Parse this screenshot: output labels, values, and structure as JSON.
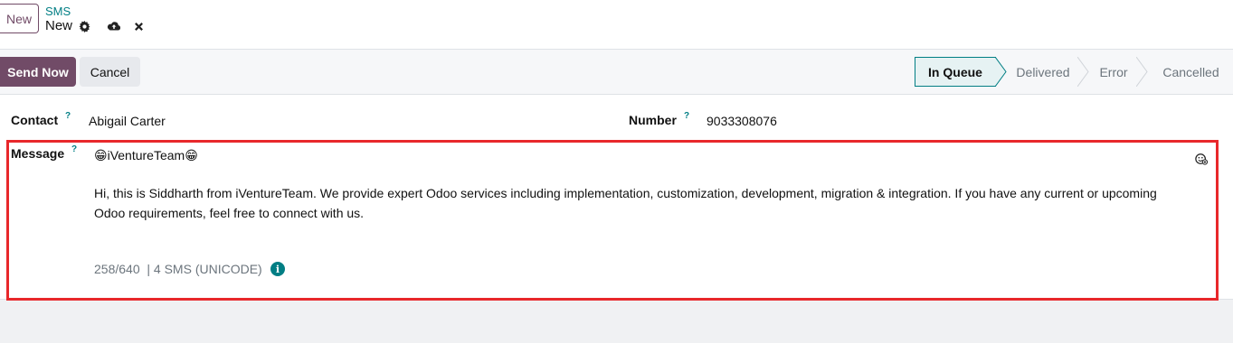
{
  "control_panel": {
    "new_button": "New",
    "breadcrumb": "SMS",
    "record_title": "New",
    "icons": [
      "gear-icon",
      "cloud-upload-icon",
      "close-icon"
    ]
  },
  "status_bar": {
    "send_button": "Send Now",
    "cancel_button": "Cancel",
    "stages": [
      {
        "label": "In Queue",
        "active": true
      },
      {
        "label": "Delivered",
        "active": false
      },
      {
        "label": "Error",
        "active": false
      },
      {
        "label": "Cancelled",
        "active": false
      }
    ]
  },
  "form": {
    "contact_label": "Contact",
    "contact_value": "Abigail Carter",
    "number_label": "Number",
    "number_value": "9033308076",
    "help_mark": "?",
    "message_label": "Message",
    "message_title": "😁iVentureTeam😁",
    "message_body": "Hi, this is Siddharth from iVentureTeam. We provide expert Odoo services including implementation, customization, development, migration & integration. If you have any current or upcoming Odoo requirements, feel free to connect with us.",
    "counter": "258/640  | 4 SMS (UNICODE)",
    "info_icon": "info-icon",
    "emoji_icon": "emoji-picker-icon"
  },
  "colors": {
    "brand": "#714b67",
    "accent": "#017e84",
    "highlight": "#e8282b"
  }
}
